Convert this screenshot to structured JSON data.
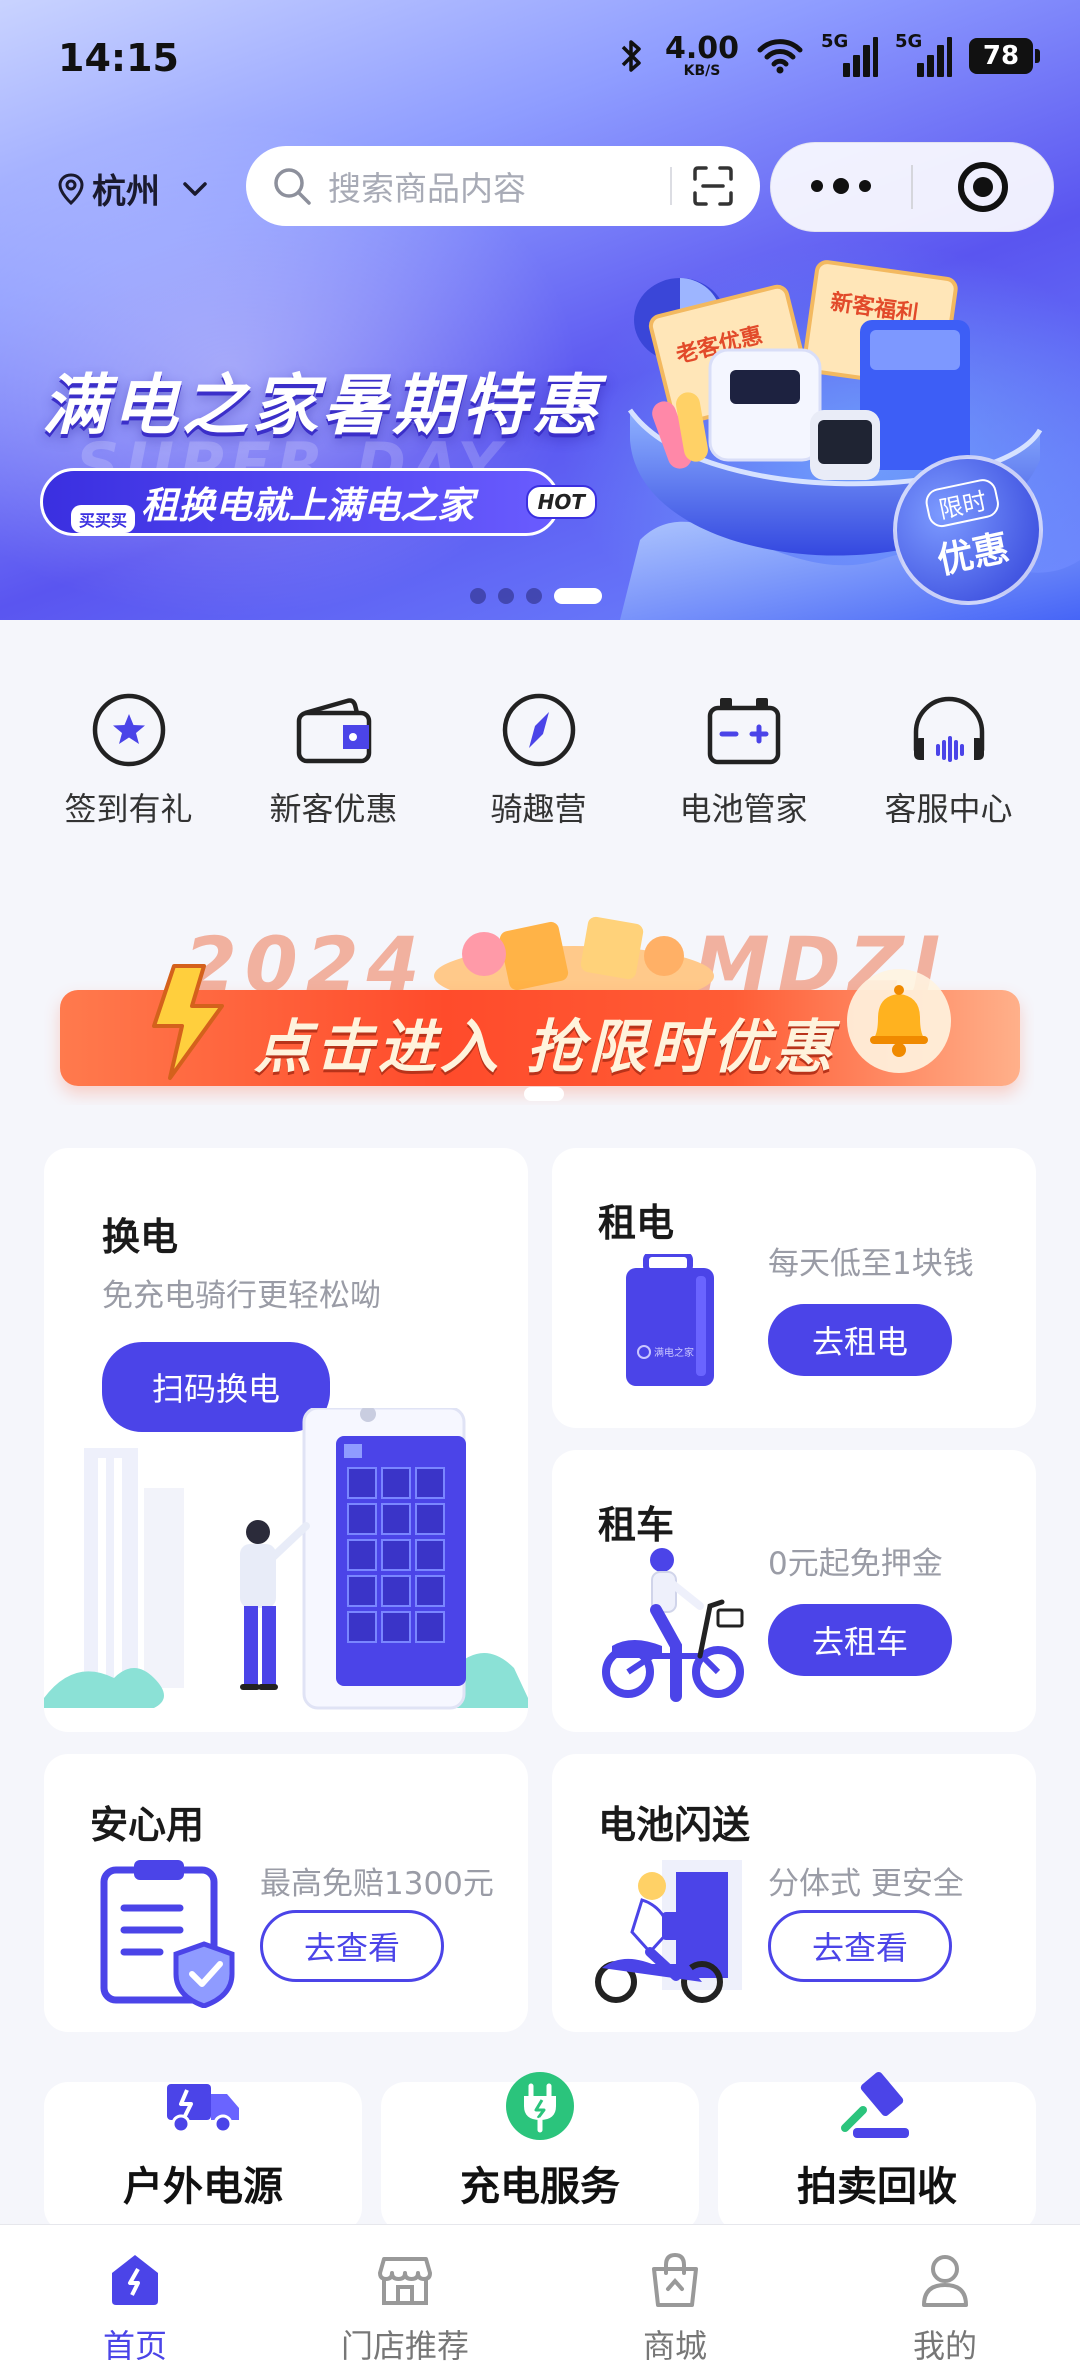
{
  "status_bar": {
    "time": "14:15",
    "network_speed": "4.00",
    "network_unit": "KB/S",
    "signal1": "5G",
    "signal2": "5G",
    "battery": "78"
  },
  "header": {
    "city": "杭州",
    "search_placeholder": "搜索商品内容"
  },
  "hero": {
    "title": "满电之家暑期特惠",
    "ghost_text": "SUPER DAY",
    "subtitle": "租换电就上满电之家",
    "tag_buy": "买买买",
    "tag_hot": "HOT",
    "badge_top": "限时",
    "badge_bottom": "优惠",
    "ticket1": "老客优惠",
    "ticket2": "新客福利",
    "carousel_active_index": 4,
    "carousel_count": 4
  },
  "quick_actions": [
    {
      "label": "签到有礼",
      "icon": "star-circle-icon"
    },
    {
      "label": "新客优惠",
      "icon": "wallet-icon"
    },
    {
      "label": "骑趣营",
      "icon": "compass-icon"
    },
    {
      "label": "电池管家",
      "icon": "battery-icon"
    },
    {
      "label": "客服中心",
      "icon": "headset-icon"
    }
  ],
  "promo": {
    "bg_left": "2024",
    "bg_right": "MDZJ",
    "text": "点击进入 抢限时优惠"
  },
  "cards": {
    "swap": {
      "title": "换电",
      "sub": "免充电骑行更轻松呦",
      "button": "扫码换电"
    },
    "rent_battery": {
      "title": "租电",
      "sub": "每天低至1块钱",
      "button": "去租电",
      "battery_brand": "满电之家"
    },
    "rent_bike": {
      "title": "租车",
      "sub": "0元起免押金",
      "button": "去租车"
    },
    "insurance": {
      "title": "安心用",
      "sub": "最高免赔1300元",
      "button": "去查看"
    },
    "delivery": {
      "title": "电池闪送",
      "sub": "分体式 更安全",
      "button": "去查看"
    }
  },
  "services": [
    {
      "label": "户外电源",
      "icon": "truck-icon"
    },
    {
      "label": "充电服务",
      "icon": "charging-plug-icon"
    },
    {
      "label": "拍卖回收",
      "icon": "auction-hammer-icon"
    }
  ],
  "tabs": [
    {
      "label": "首页",
      "icon": "home-icon",
      "active": true
    },
    {
      "label": "门店推荐",
      "icon": "store-icon",
      "active": false
    },
    {
      "label": "商城",
      "icon": "shopping-bag-icon",
      "active": false
    },
    {
      "label": "我的",
      "icon": "user-icon",
      "active": false
    }
  ],
  "colors": {
    "accent": "#4b44e8",
    "promo_orange": "#ff4b2b",
    "hero_blue": "#5a55f0"
  }
}
